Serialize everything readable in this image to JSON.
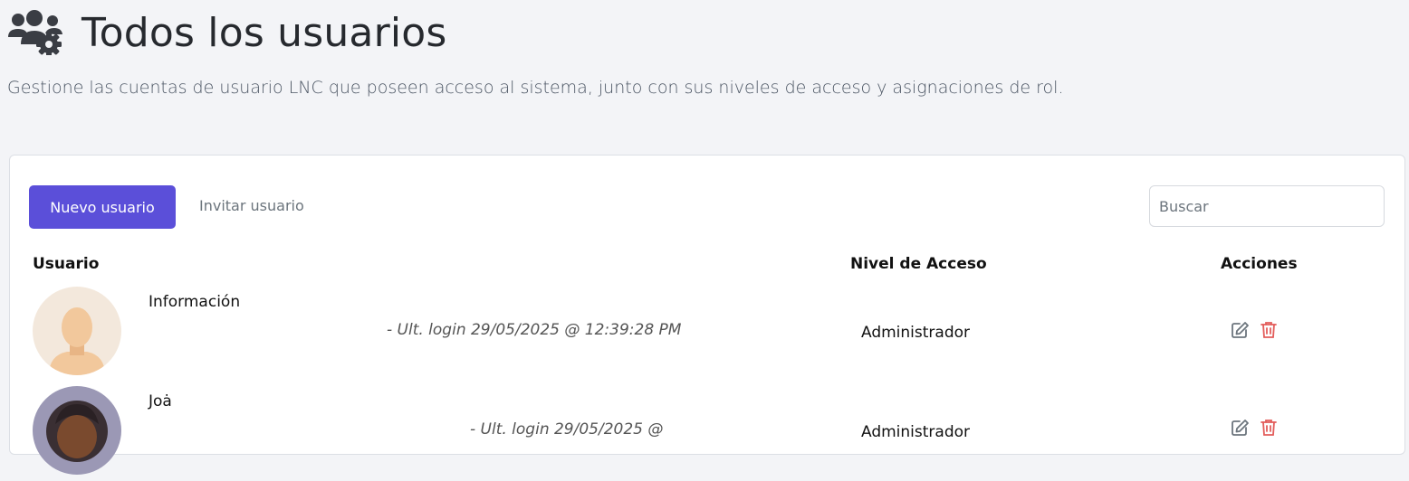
{
  "header": {
    "title": "Todos los usuarios",
    "subtitle": "Gestione las cuentas de usuario LNC que poseen acceso al sistema, junto con sus niveles de acceso y asignaciones de rol.",
    "icon": "users-cog-icon"
  },
  "toolbar": {
    "new_user_label": "Nuevo usuario",
    "invite_user_label": "Invitar usuario",
    "search_placeholder": "Buscar"
  },
  "table": {
    "columns": [
      "Usuario",
      "Nivel de Acceso",
      "Acciones"
    ],
    "rows": [
      {
        "name": "Información",
        "login": "- Ult. login 29/05/2025 @ 12:39:28 PM",
        "level": "Administrador"
      },
      {
        "name": "Joȧ",
        "login": "- Ult. login 29/05/2025 @",
        "level": "Administrador"
      }
    ]
  },
  "colors": {
    "accent": "#5b4fd9",
    "delete": "#e35d5b",
    "edit": "#6c757d",
    "background": "#f3f4f7"
  }
}
